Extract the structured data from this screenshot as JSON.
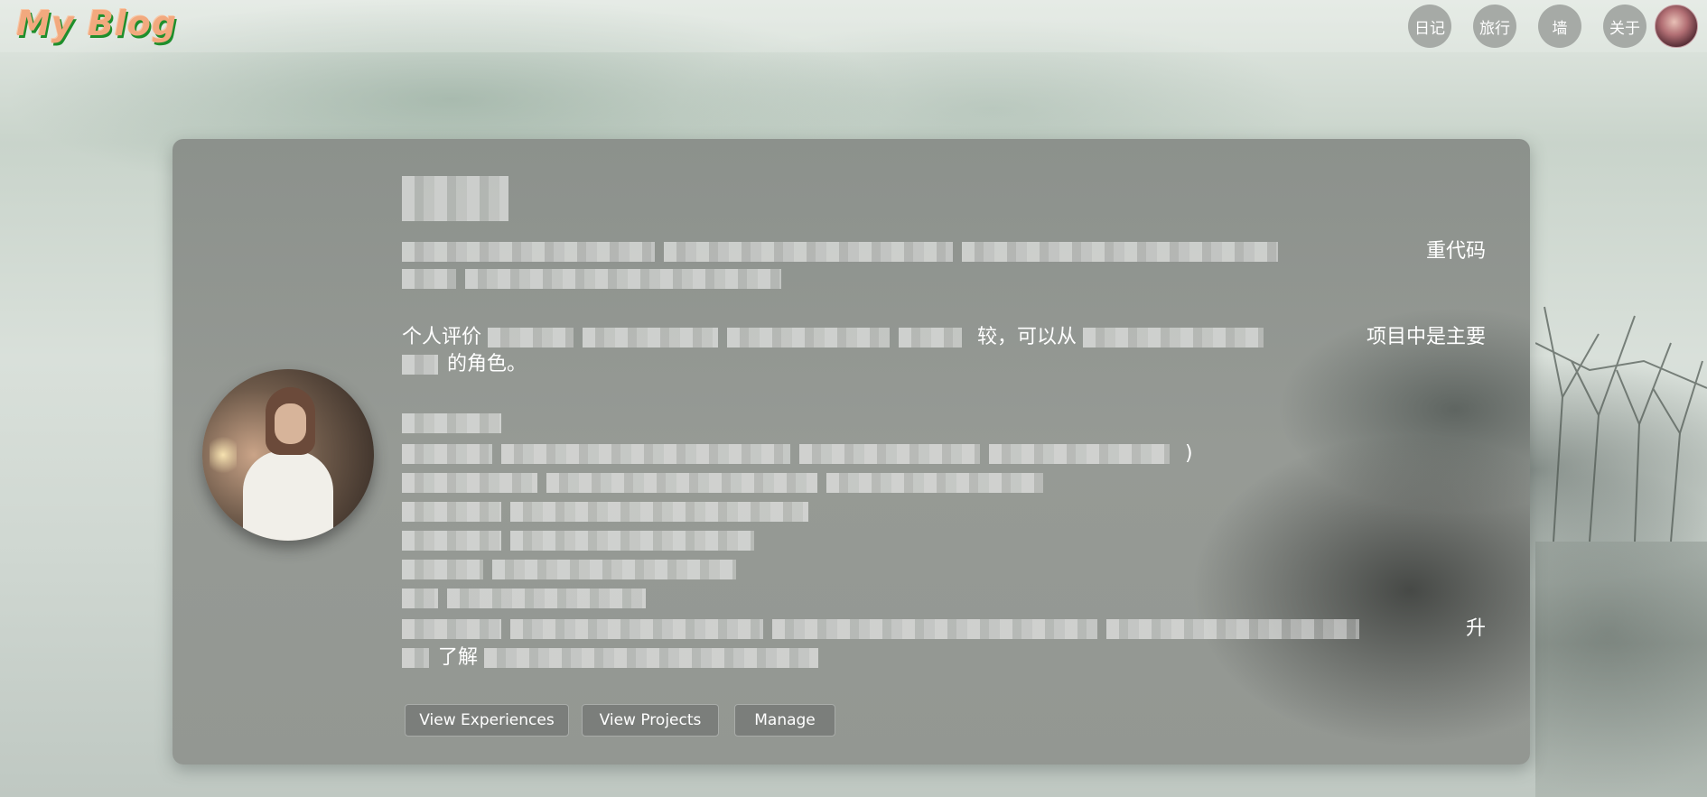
{
  "header": {
    "logo_text": "My Blog",
    "nav": [
      {
        "label": "日记"
      },
      {
        "label": "旅行"
      },
      {
        "label": "墙"
      },
      {
        "label": "关于"
      }
    ]
  },
  "profile": {
    "intro_visible_tail": "重代码",
    "evaluation_prefix": "个人评价",
    "evaluation_fragment": "较，可以从",
    "evaluation_tail": "项目中是主要",
    "evaluation_line2": "的角色。",
    "skill_line_tail": ")",
    "last_line_fragment": "了解",
    "last_line_tail": "升"
  },
  "actions": {
    "view_experiences": "View Experiences",
    "view_projects": "View Projects",
    "manage": "Manage"
  },
  "colors": {
    "card_bg": "#939792",
    "button_bg": "#7b7e7b",
    "nav_bg": "#a6aaa6",
    "logo_color": "#f2a97e",
    "logo_shadow": "#1f8f2c"
  }
}
